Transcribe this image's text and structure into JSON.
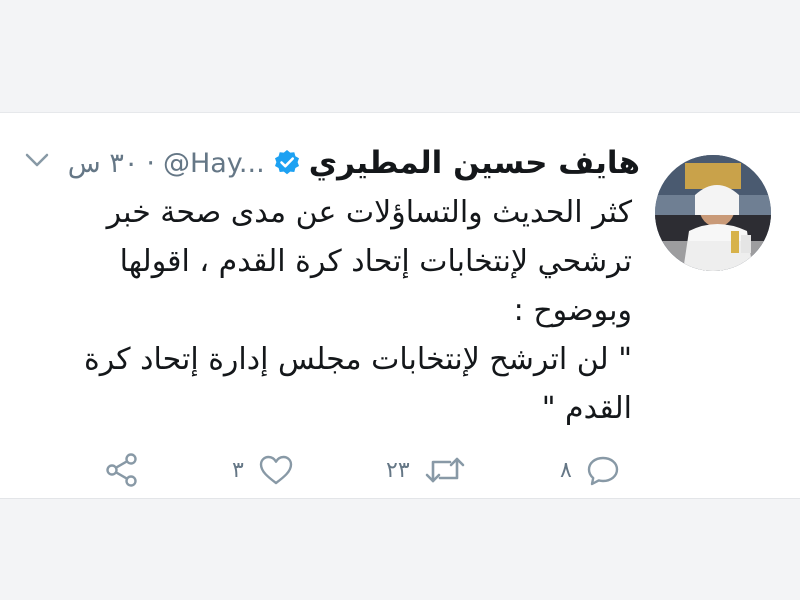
{
  "tweet": {
    "display_name": "هايف حسين المطيري",
    "handle": "@Hay...",
    "separator": "·",
    "timestamp": "٣٠ س",
    "lines": [
      "كثر الحديث والتساؤلات عن مدى صحة خبر",
      "ترشحي لإنتخابات إتحاد كرة القدم ، اقولها",
      "وبوضوح :",
      "\" لن اترشح لإنتخابات مجلس إدارة إتحاد كرة",
      "القدم \""
    ],
    "actions": {
      "reply_count": "٨",
      "retweet_count": "٢٣",
      "like_count": "٣"
    }
  },
  "icons": {
    "verified": "verified-badge-icon",
    "menu": "chevron-down-icon",
    "reply": "reply-icon",
    "retweet": "retweet-icon",
    "like": "heart-icon",
    "share": "share-icon"
  },
  "colors": {
    "text": "#14171a",
    "secondary": "#657786",
    "verified": "#1da1f2",
    "background": "#f3f4f6",
    "card": "#ffffff"
  }
}
